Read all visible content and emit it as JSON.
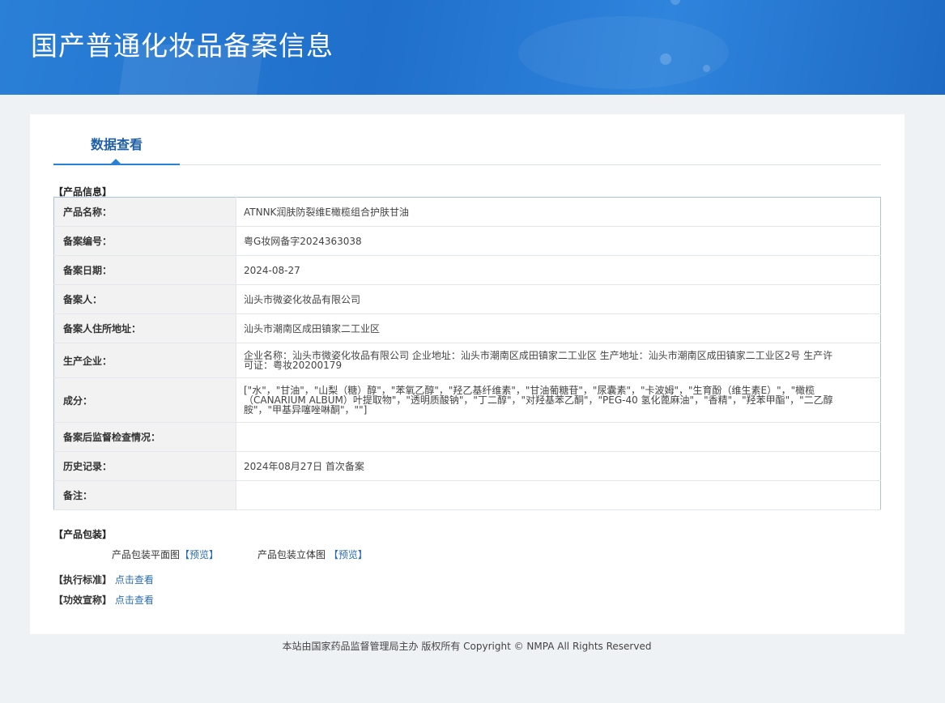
{
  "banner": {
    "title": "国产普通化妆品备案信息"
  },
  "tabs": [
    {
      "label": "数据查看"
    }
  ],
  "product_info": {
    "section_title": "【产品信息】",
    "rows": [
      {
        "label": "产品名称：",
        "value": "ATNNK润肤防裂维E橄榄组合护肤甘油"
      },
      {
        "label": "备案编号：",
        "value": "粤G妆网备字2024363038"
      },
      {
        "label": "备案日期：",
        "value": "2024-08-27"
      },
      {
        "label": "备案人：",
        "value": "汕头市微姿化妆品有限公司"
      },
      {
        "label": "备案人住所地址：",
        "value": "汕头市潮南区成田镇家二工业区"
      },
      {
        "label": "生产企业：",
        "value": "企业名称：汕头市微姿化妆品有限公司 企业地址：汕头市潮南区成田镇家二工业区 生产地址：汕头市潮南区成田镇家二工业区2号 生产许可证：粤妆20200179"
      },
      {
        "label": "成分：",
        "value": "[\"水\"，\"甘油\"，\"山梨（糖）醇\"，\"苯氧乙醇\"，\"羟乙基纤维素\"，\"甘油葡糖苷\"，\"尿囊素\"，\"卡波姆\"，\"生育酚（维生素E）\"，\"橄榄（CANARIUM ALBUM）叶提取物\"，\"透明质酸钠\"，\"丁二醇\"，\"对羟基苯乙酮\"，\"PEG-40 氢化蓖麻油\"，\"香精\"，\"羟苯甲酯\"，\"二乙醇胺\"，\"甲基异噻唑啉酮\"，\"\"]"
      },
      {
        "label": "备案后监督检查情况：",
        "value": ""
      },
      {
        "label": "历史记录：",
        "value": "2024年08月27日 首次备案"
      },
      {
        "label": "备注：",
        "value": ""
      }
    ]
  },
  "packaging": {
    "section_title": "【产品包装】",
    "flat_label": "产品包装平面图",
    "flat_link": "【预览】",
    "solid_label": "产品包装立体图",
    "solid_link": "【预览】"
  },
  "standard": {
    "label": "【执行标准】",
    "link": "点击查看"
  },
  "efficacy": {
    "label": "【功效宣称】",
    "link": "点击查看"
  },
  "footer": {
    "text": "本站由国家药品监督管理局主办 版权所有 Copyright © NMPA All Rights Reserved"
  }
}
